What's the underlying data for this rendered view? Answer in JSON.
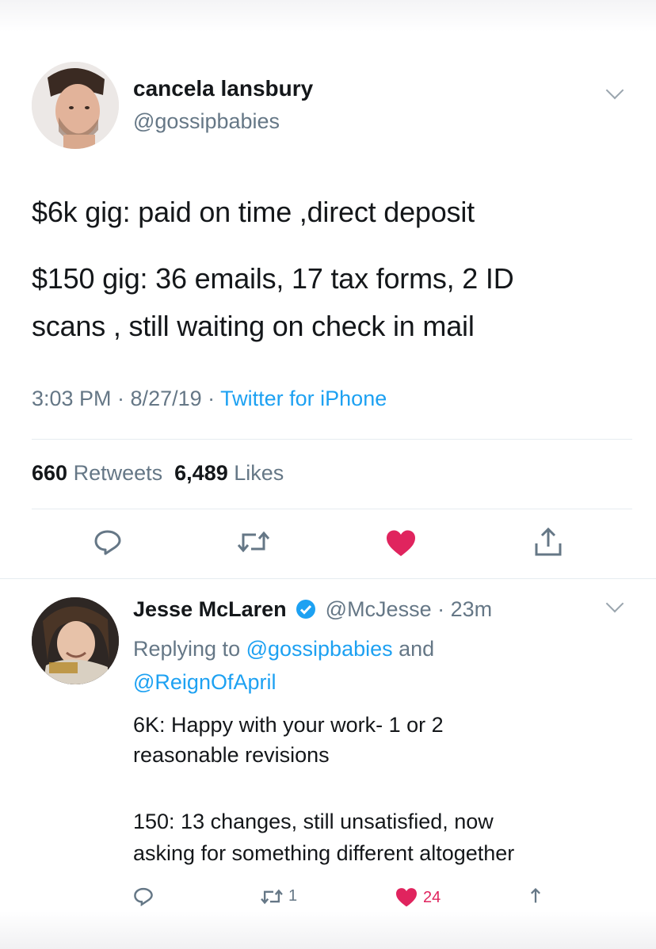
{
  "main_tweet": {
    "display_name": "cancela lansbury",
    "handle": "@gossipbabies",
    "lines": [
      "$6k gig: paid on time ,direct deposit",
      "$150 gig: 36 emails, 17 tax forms, 2 ID",
      "scans , still waiting on check in mail"
    ],
    "time": "3:03 PM · 8/27/19 · ",
    "source": "Twitter for iPhone",
    "retweet_count": "660",
    "retweet_label": "Retweets",
    "like_count": "6,489",
    "like_label": "Likes",
    "like_color": "#e0245e"
  },
  "reply_tweet": {
    "display_name": "Jesse McLaren",
    "handle_time": "@McJesse · 23m",
    "replying_prefix": "Replying to ",
    "mention_1": "@gossipbabies",
    "replying_and": " and",
    "mention_2": "@ReignOfApril",
    "lines": [
      "6K: Happy with your work- 1 or 2",
      "reasonable revisions",
      "150: 13 changes, still unsatisfied, now",
      "asking for something different altogether"
    ],
    "retweet_count": "1",
    "like_count": "24"
  },
  "icons": [
    "reply-icon",
    "retweet-icon",
    "heart-icon",
    "share-icon",
    "verified-icon",
    "chevron-down-icon"
  ],
  "colors": {
    "link": "#1da1f2",
    "muted": "#657786",
    "text": "#14171a",
    "like": "#e0245e"
  }
}
